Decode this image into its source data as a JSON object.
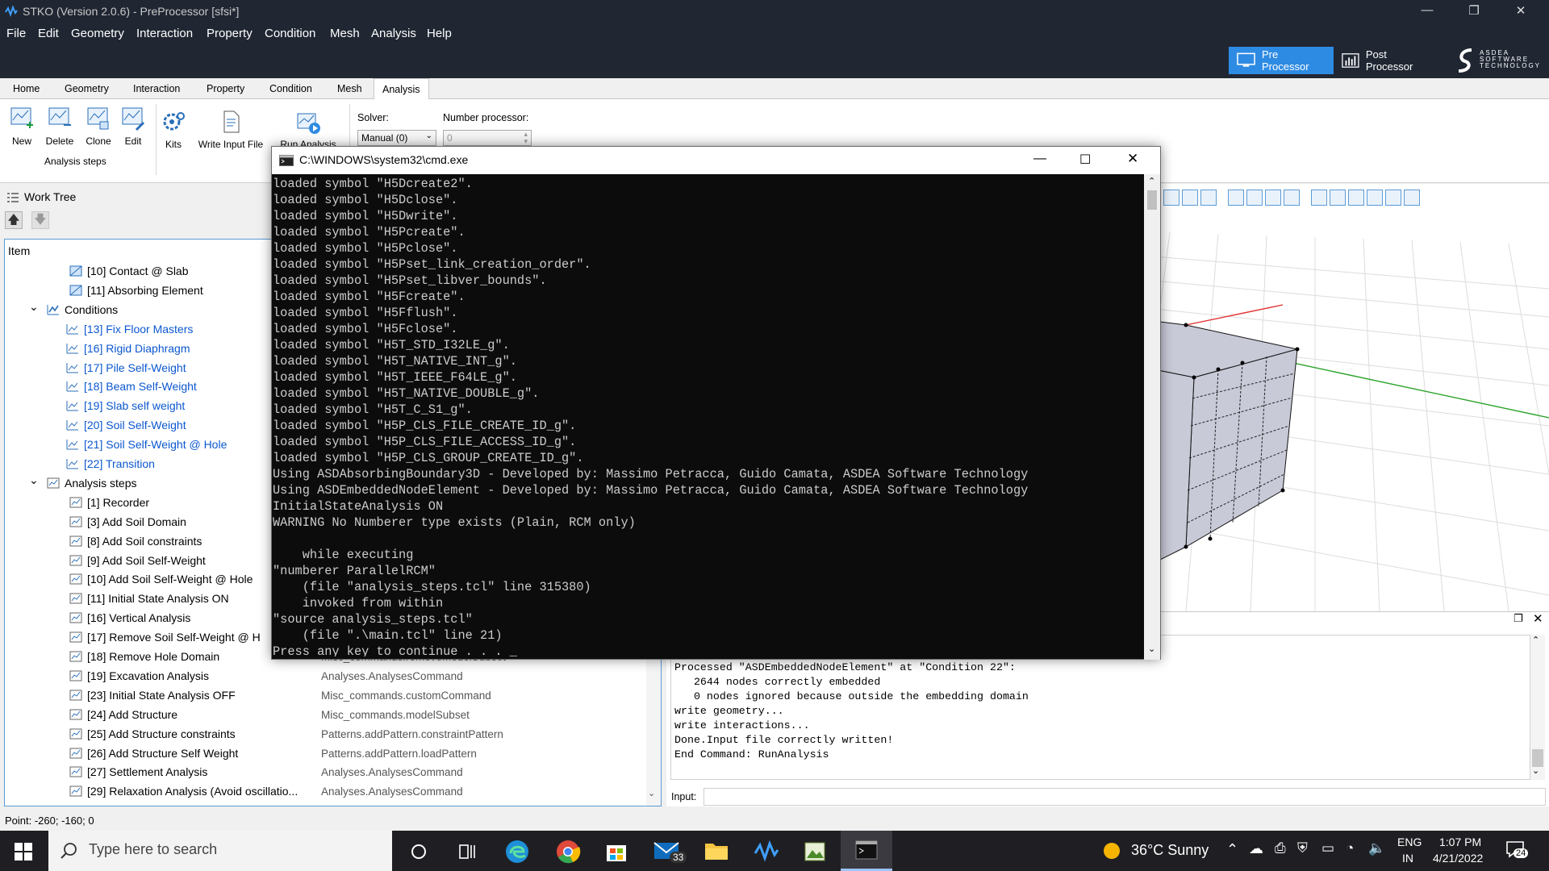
{
  "window": {
    "title": "STKO (Version 2.0.6) - PreProcessor [sfsi*]"
  },
  "menu": [
    "File",
    "Edit",
    "Geometry",
    "Interaction",
    "Property",
    "Condition",
    "Mesh",
    "Analysis",
    "Help"
  ],
  "modes": {
    "pre": "Pre Processor",
    "post": "Post Processor",
    "logo_lines": [
      "ASDEA",
      "SOFTWARE",
      "TECHNOLOGY"
    ]
  },
  "ribbon_tabs": [
    "Home",
    "Geometry",
    "Interaction",
    "Property",
    "Condition",
    "Mesh",
    "Analysis"
  ],
  "ribbon": {
    "buttons": [
      "New",
      "Delete",
      "Clone",
      "Edit",
      "Kits",
      "Write Input File",
      "Run Analysis"
    ],
    "group_label": "Analysis steps",
    "solver_label": "Solver:",
    "solver_value": "Manual (0)",
    "nproc_label": "Number processor:",
    "nproc_value": "0"
  },
  "worktree": {
    "title": "Work Tree",
    "col_header": "Item",
    "rows": [
      {
        "label": "[10] Contact @ Slab",
        "type": ""
      },
      {
        "label": "[11] Absorbing Element",
        "type": ""
      },
      {
        "label": "Conditions",
        "type": ""
      },
      {
        "label": "[13] Fix Floor Masters",
        "type": ""
      },
      {
        "label": "[16] Rigid Diaphragm",
        "type": ""
      },
      {
        "label": "[17] Pile Self-Weight",
        "type": ""
      },
      {
        "label": "[18] Beam Self-Weight",
        "type": ""
      },
      {
        "label": "[19] Slab self weight",
        "type": ""
      },
      {
        "label": "[20] Soil Self-Weight",
        "type": ""
      },
      {
        "label": "[21] Soil Self-Weight @ Hole",
        "type": ""
      },
      {
        "label": "[22] Transition",
        "type": ""
      },
      {
        "label": "Analysis steps",
        "type": ""
      },
      {
        "label": "[1] Recorder",
        "type": ""
      },
      {
        "label": "[3] Add Soil Domain",
        "type": ""
      },
      {
        "label": "[8] Add Soil constraints",
        "type": ""
      },
      {
        "label": "[9] Add Soil Self-Weight",
        "type": ""
      },
      {
        "label": "[10] Add Soil Self-Weight @ Hole",
        "type": ""
      },
      {
        "label": "[11] Initial State Analysis ON",
        "type": ""
      },
      {
        "label": "[16] Vertical Analysis",
        "type": ""
      },
      {
        "label": "[17] Remove Soil Self-Weight @ H",
        "type": ""
      },
      {
        "label": "[18] Remove Hole Domain",
        "type": "Misc_commands.removeModelSubset"
      },
      {
        "label": "[19] Excavation Analysis",
        "type": "Analyses.AnalysesCommand"
      },
      {
        "label": "[23] Initial State Analysis OFF",
        "type": "Misc_commands.customCommand"
      },
      {
        "label": "[24] Add Structure",
        "type": "Misc_commands.modelSubset"
      },
      {
        "label": "[25] Add Structure constraints",
        "type": "Patterns.addPattern.constraintPattern"
      },
      {
        "label": "[26] Add Structure Self Weight",
        "type": "Patterns.addPattern.loadPattern"
      },
      {
        "label": "[27] Settlement Analysis",
        "type": "Analyses.AnalysesCommand"
      },
      {
        "label": "[29] Relaxation Analysis (Avoid oscillatio...",
        "type": "Analyses.AnalysesCommand"
      }
    ]
  },
  "output": {
    "lines": [
      "Processed \"ASDEmbeddedNodeElement\" at \"Condition 22\":",
      "   2644 nodes correctly embedded",
      "   0 nodes ignored because outside the embedding domain",
      "write geometry...",
      "write interactions...",
      "Done.Input file correctly written!",
      "End Command: RunAnalysis"
    ],
    "input_label": "Input:"
  },
  "status": {
    "point": "Point: -260; -160; 0"
  },
  "cmd": {
    "title": "C:\\WINDOWS\\system32\\cmd.exe",
    "lines": [
      "loaded symbol \"H5Dcreate2\".",
      "loaded symbol \"H5Dclose\".",
      "loaded symbol \"H5Dwrite\".",
      "loaded symbol \"H5Pcreate\".",
      "loaded symbol \"H5Pclose\".",
      "loaded symbol \"H5Pset_link_creation_order\".",
      "loaded symbol \"H5Pset_libver_bounds\".",
      "loaded symbol \"H5Fcreate\".",
      "loaded symbol \"H5Fflush\".",
      "loaded symbol \"H5Fclose\".",
      "loaded symbol \"H5T_STD_I32LE_g\".",
      "loaded symbol \"H5T_NATIVE_INT_g\".",
      "loaded symbol \"H5T_IEEE_F64LE_g\".",
      "loaded symbol \"H5T_NATIVE_DOUBLE_g\".",
      "loaded symbol \"H5T_C_S1_g\".",
      "loaded symbol \"H5P_CLS_FILE_CREATE_ID_g\".",
      "loaded symbol \"H5P_CLS_FILE_ACCESS_ID_g\".",
      "loaded symbol \"H5P_CLS_GROUP_CREATE_ID_g\".",
      "Using ASDAbsorbingBoundary3D - Developed by: Massimo Petracca, Guido Camata, ASDEA Software Technology",
      "Using ASDEmbeddedNodeElement - Developed by: Massimo Petracca, Guido Camata, ASDEA Software Technology",
      "InitialStateAnalysis ON",
      "WARNING No Numberer type exists (Plain, RCM only)",
      "",
      "    while executing",
      "\"numberer ParallelRCM\"",
      "    (file \"analysis_steps.tcl\" line 315380)",
      "    invoked from within",
      "\"source analysis_steps.tcl\"",
      "    (file \".\\main.tcl\" line 21)",
      "Press any key to continue . . . _"
    ]
  },
  "taskbar": {
    "search_placeholder": "Type here to search",
    "mail_badge": "33",
    "weather": "36°C  Sunny",
    "lang1": "ENG",
    "lang2": "IN",
    "time": "1:07 PM",
    "date": "4/21/2022",
    "notif_count": "24"
  }
}
